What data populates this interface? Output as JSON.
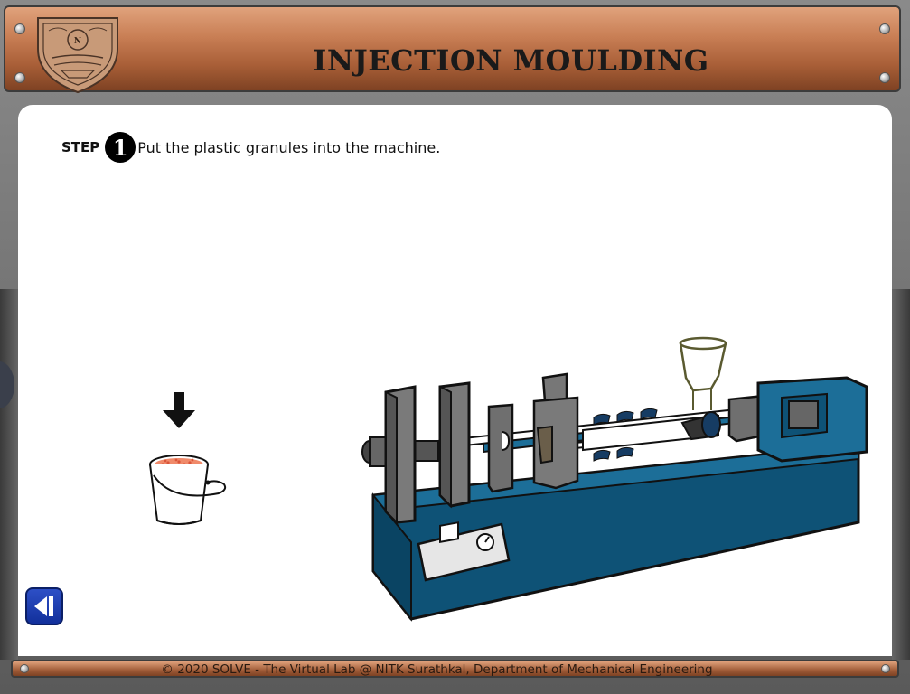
{
  "header": {
    "title": "INJECTION MOULDING"
  },
  "instruction": {
    "step_label": "STEP",
    "step_number": "1",
    "text": "Put the plastic granules into the machine."
  },
  "icons": {
    "logo": "nitk-emblem-icon",
    "arrow": "arrow-down-icon",
    "bucket": "granule-bucket-icon",
    "machine": "injection-moulding-machine-illustration",
    "back": "back-button-icon"
  },
  "colors": {
    "header_brown": "#b46a42",
    "machine_blue": "#0e5276",
    "back_button_blue": "#1f3fb5"
  },
  "footer": {
    "text": "© 2020 SOLVE - The Virtual Lab @ NITK Surathkal, Department of Mechanical Engineering"
  }
}
